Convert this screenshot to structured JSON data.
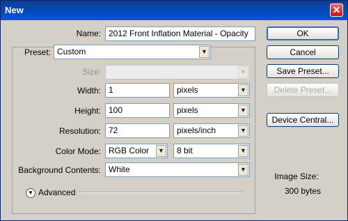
{
  "window": {
    "title": "New",
    "close_glyph": "✕"
  },
  "form": {
    "name_label": "Name:",
    "name_value": "2012 Front Inflation Material - Opacity",
    "preset_label": "Preset:",
    "preset_value": "Custom",
    "size_label": "Size:",
    "size_value": "",
    "width_label": "Width:",
    "width_value": "1",
    "width_unit": "pixels",
    "height_label": "Height:",
    "height_value": "100",
    "height_unit": "pixels",
    "resolution_label": "Resolution:",
    "resolution_value": "72",
    "resolution_unit": "pixels/inch",
    "color_mode_label": "Color Mode:",
    "color_mode_value": "RGB Color",
    "bit_depth_value": "8 bit",
    "background_label": "Background Contents:",
    "background_value": "White",
    "advanced_label": "Advanced"
  },
  "buttons": {
    "ok": "OK",
    "cancel": "Cancel",
    "save_preset": "Save Preset...",
    "delete_preset": "Delete Preset...",
    "device_central": "Device Central..."
  },
  "image_size": {
    "label": "Image Size:",
    "value": "300 bytes"
  },
  "icons": {
    "dropdown": "chevron-down-icon",
    "advanced": "double-chevron-down-icon"
  }
}
